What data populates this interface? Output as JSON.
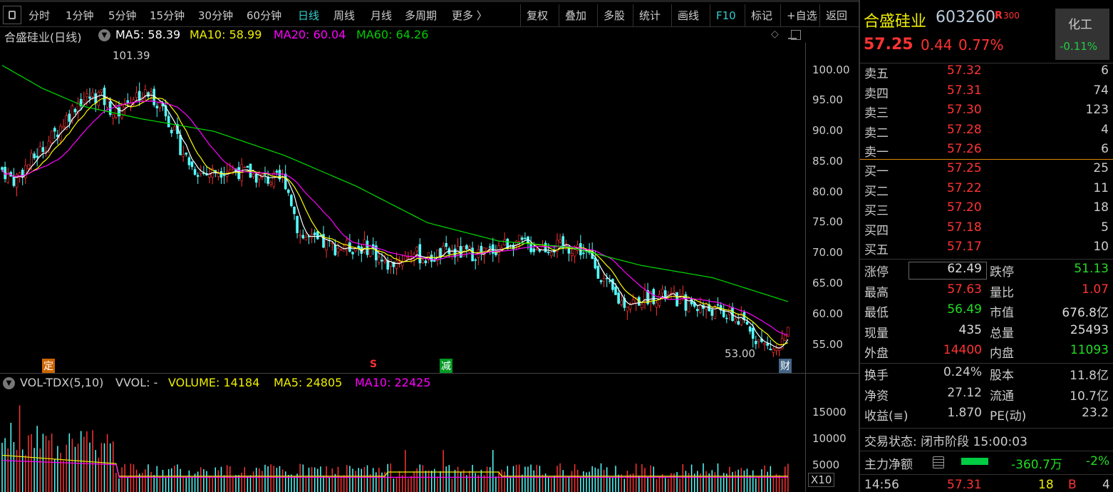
{
  "toolbar": {
    "left": [
      "分时",
      "1分钟",
      "5分钟",
      "15分钟",
      "30分钟",
      "60分钟",
      "日线",
      "周线",
      "月线",
      "多周期",
      "更多 〉"
    ],
    "selected": "日线",
    "right": [
      "复权",
      "叠加",
      "多股",
      "统计",
      "画线",
      "F10",
      "标记",
      "+自选",
      "返回"
    ]
  },
  "chart": {
    "title": "合盛硅业(日线)",
    "ma5": "MA5: 58.39",
    "ma10": "MA10: 58.99",
    "ma20": "MA20: 60.04",
    "ma60": "MA60: 64.26",
    "high_label": "101.39",
    "low_label": "53.00",
    "markers": [
      "定",
      "S",
      "减",
      "财"
    ],
    "price_axis": [
      "100.00",
      "95.00",
      "90.00",
      "85.00",
      "80.00",
      "75.00",
      "70.00",
      "65.00",
      "60.00",
      "55.00"
    ],
    "price_range": [
      50.5,
      104.5
    ],
    "price_path": [
      [
        0,
        84
      ],
      [
        20,
        82
      ],
      [
        50,
        86
      ],
      [
        80,
        90
      ],
      [
        110,
        95
      ],
      [
        140,
        96
      ],
      [
        160,
        93
      ],
      [
        190,
        96
      ],
      [
        210,
        96
      ],
      [
        230,
        94
      ],
      [
        250,
        88
      ],
      [
        270,
        84
      ],
      [
        290,
        83
      ],
      [
        320,
        84
      ],
      [
        350,
        83
      ],
      [
        380,
        82
      ],
      [
        400,
        82
      ],
      [
        410,
        78
      ],
      [
        420,
        73
      ],
      [
        440,
        72
      ],
      [
        470,
        71
      ],
      [
        500,
        71
      ],
      [
        520,
        71
      ],
      [
        540,
        68
      ],
      [
        560,
        69
      ],
      [
        580,
        70
      ],
      [
        600,
        69
      ],
      [
        620,
        70
      ],
      [
        640,
        70
      ],
      [
        660,
        70
      ],
      [
        680,
        70
      ],
      [
        700,
        71
      ],
      [
        720,
        72
      ],
      [
        750,
        71
      ],
      [
        780,
        71
      ],
      [
        810,
        71
      ],
      [
        830,
        69
      ],
      [
        850,
        65
      ],
      [
        870,
        62
      ],
      [
        890,
        62
      ],
      [
        910,
        63
      ],
      [
        930,
        63
      ],
      [
        960,
        62
      ],
      [
        990,
        61
      ],
      [
        1020,
        60
      ],
      [
        1050,
        58
      ],
      [
        1070,
        55
      ],
      [
        1090,
        54
      ],
      [
        1108,
        57
      ]
    ],
    "ma60_path": [
      [
        0,
        101
      ],
      [
        60,
        97
      ],
      [
        120,
        94
      ],
      [
        200,
        92
      ],
      [
        300,
        90
      ],
      [
        400,
        86
      ],
      [
        500,
        81
      ],
      [
        600,
        75
      ],
      [
        700,
        72
      ],
      [
        800,
        71
      ],
      [
        900,
        68
      ],
      [
        1000,
        66
      ],
      [
        1108,
        62
      ]
    ],
    "colors": {
      "ma5": "#ffffff",
      "ma10": "#ffff00",
      "ma20": "#ff00ff",
      "ma60": "#00dd00",
      "up": "#ff3232",
      "down": "#54ffff"
    }
  },
  "volume": {
    "title": "VOL-TDX(5,10)",
    "vvol": "VVOL: -",
    "volume": "VOLUME: 14184",
    "ma5": "MA5: 24805",
    "ma10": "MA10: 22425",
    "axis": [
      "15000",
      "10000",
      "5000"
    ],
    "unit": "X10",
    "range": [
      0,
      19000
    ]
  },
  "quote": {
    "name": "合盛硅业",
    "code": "603260",
    "tag_r": "R",
    "tag_num": "300",
    "price": "57.25",
    "change": "0.44",
    "pct": "0.77%",
    "sector": "化工",
    "sector_pct": "-0.11%"
  },
  "asks": [
    {
      "label": "卖五",
      "price": "57.32",
      "vol": "6"
    },
    {
      "label": "卖四",
      "price": "57.31",
      "vol": "74"
    },
    {
      "label": "卖三",
      "price": "57.30",
      "vol": "123"
    },
    {
      "label": "卖二",
      "price": "57.28",
      "vol": "4"
    },
    {
      "label": "卖一",
      "price": "57.26",
      "vol": "6"
    }
  ],
  "bids": [
    {
      "label": "买一",
      "price": "57.25",
      "vol": "25"
    },
    {
      "label": "买二",
      "price": "57.22",
      "vol": "11"
    },
    {
      "label": "买三",
      "price": "57.20",
      "vol": "18"
    },
    {
      "label": "买四",
      "price": "57.18",
      "vol": "5"
    },
    {
      "label": "买五",
      "price": "57.17",
      "vol": "10"
    }
  ],
  "stats1": [
    [
      "涨停",
      "62.49",
      "跌停",
      "51.13"
    ],
    [
      "最高",
      "57.63",
      "量比",
      "1.07"
    ],
    [
      "最低",
      "56.49",
      "市值",
      "676.8亿"
    ],
    [
      "现量",
      "435",
      "总量",
      "25493"
    ],
    [
      "外盘",
      "14400",
      "内盘",
      "11093"
    ]
  ],
  "stats2": [
    [
      "换手",
      "0.24%",
      "股本",
      "11.8亿"
    ],
    [
      "净资",
      "27.12",
      "流通",
      "10.7亿"
    ],
    [
      "收益(≡)",
      "1.870",
      "PE(动)",
      "23.2"
    ]
  ],
  "status": "交易状态: 闭市阶段 15:00:03",
  "main_flow": {
    "label": "主力净额",
    "value": "-360.7万",
    "pct": "-2%"
  },
  "tick": {
    "time": "14:56",
    "price": "57.31",
    "vol": "18",
    "side": "B",
    "count": "4"
  }
}
